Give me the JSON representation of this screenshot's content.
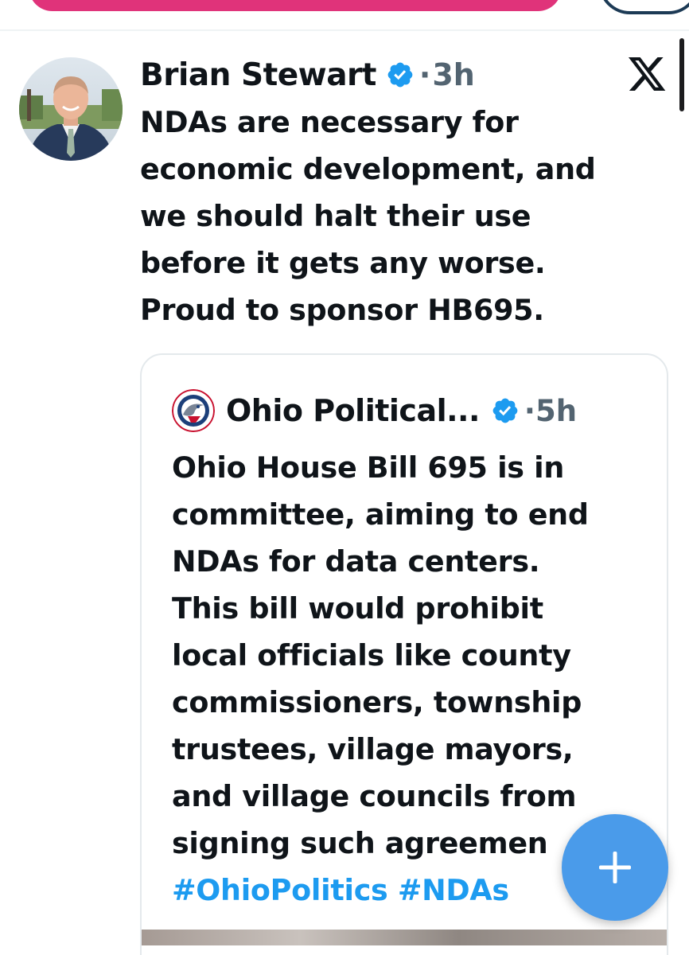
{
  "main_tweet": {
    "author_name": "Brian Stewart",
    "dot": "·",
    "time": "3h",
    "text_lines": [
      "NDAs are necessary for",
      "economic development, and",
      "we should halt their use",
      "before it gets any worse.",
      "Proud to sponsor HB695."
    ]
  },
  "quoted_tweet": {
    "author_name": "Ohio Political...",
    "dot": "·",
    "time": "5h",
    "text_lines": [
      "Ohio House Bill 695 is in",
      "committee, aiming to end",
      "NDAs for data centers.",
      "This bill would prohibit",
      "local officials like county",
      "commissioners, township",
      "trustees, village mayors,",
      "and village councils from",
      "signing such agreemen"
    ],
    "hashtags": [
      "#OhioPolitics",
      "#NDAs"
    ]
  },
  "icons": {
    "verified": "verified-badge-icon",
    "more": "x-logo-icon",
    "compose": "plus-icon"
  },
  "colors": {
    "accent": "#1d9bf0",
    "fab": "#4a9bea",
    "muted": "#536471",
    "text": "#0f1419",
    "pink": "#e0337a"
  }
}
